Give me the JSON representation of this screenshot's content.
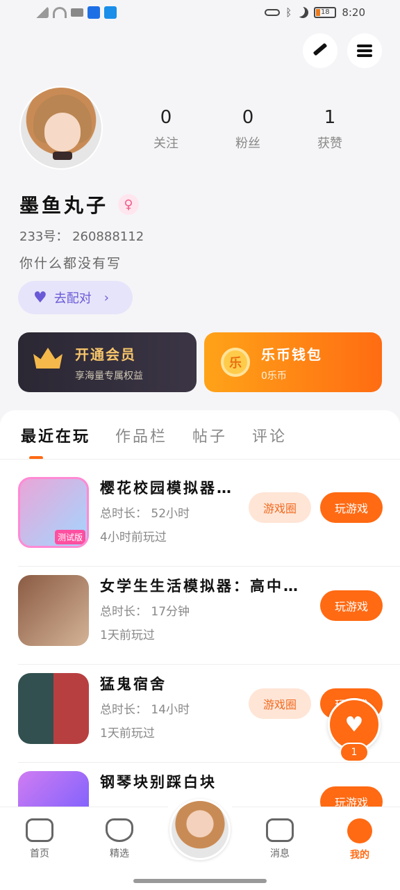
{
  "status_bar": {
    "time": "8:20",
    "battery": "18"
  },
  "profile": {
    "stats": [
      {
        "value": "0",
        "label": "关注"
      },
      {
        "value": "0",
        "label": "粉丝"
      },
      {
        "value": "1",
        "label": "获赞"
      }
    ],
    "name": "墨鱼丸子",
    "gender_icon": "♀",
    "uid": "233号： 260888112",
    "bio": "你什么都没有写",
    "match_label": "去配对"
  },
  "cards": {
    "vip": {
      "title": "开通会员",
      "subtitle": "享海量专属权益"
    },
    "wallet": {
      "title": "乐币钱包",
      "subtitle": "0乐币",
      "coin_glyph": "乐"
    }
  },
  "tabs": [
    "最近在玩",
    "作品栏",
    "帖子",
    "评论"
  ],
  "games": [
    {
      "title": "樱花校园模拟器…",
      "time": "总时长： 52小时",
      "last": "4小时前玩过",
      "circle": "游戏圈",
      "play": "玩游戏",
      "badge": "测试版"
    },
    {
      "title": "女学生生活模拟器：高中…",
      "time": "总时长： 17分钟",
      "last": "1天前玩过",
      "play": "玩游戏"
    },
    {
      "title": "猛鬼宿舍",
      "time": "总时长： 14小时",
      "last": "1天前玩过",
      "circle": "游戏圈",
      "play": "玩游戏"
    },
    {
      "title": "钢琴块别踩白块",
      "time": "",
      "last": "",
      "play": "玩游戏"
    }
  ],
  "float": {
    "count": "1"
  },
  "nav": {
    "home": "首页",
    "pick": "精选",
    "msg": "消息",
    "me": "我的"
  }
}
